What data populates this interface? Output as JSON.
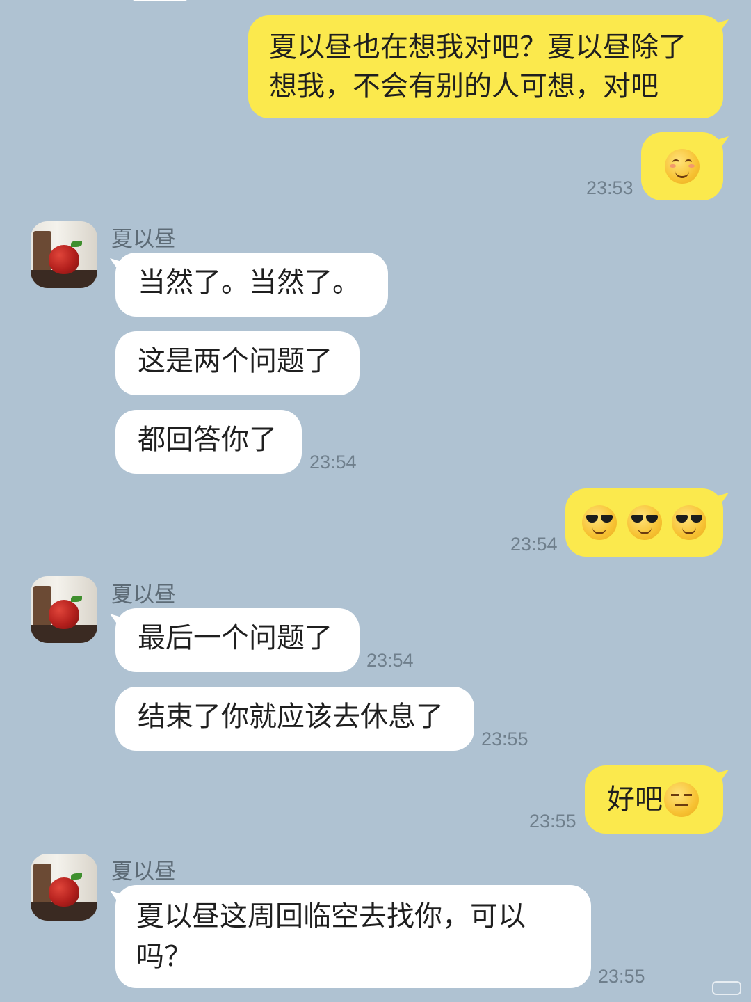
{
  "contact": {
    "name": "夏以昼"
  },
  "messages": [
    {
      "from": "me",
      "text": "夏以昼也在想我对吧？夏以昼除了想我，不会有别的人可想，对吧"
    },
    {
      "from": "me",
      "emoji": [
        "smiling-face-icon"
      ],
      "time": "23:53"
    },
    {
      "from": "contact",
      "text": "当然了。当然了。"
    },
    {
      "from": "contact",
      "text": "这是两个问题了"
    },
    {
      "from": "contact",
      "text": "都回答你了",
      "time": "23:54"
    },
    {
      "from": "me",
      "emoji": [
        "sunglasses-face-icon",
        "sunglasses-face-icon",
        "sunglasses-face-icon"
      ],
      "time": "23:54"
    },
    {
      "from": "contact",
      "text": "最后一个问题了",
      "time": "23:54"
    },
    {
      "from": "contact",
      "text": "结束了你就应该去休息了",
      "time": "23:55"
    },
    {
      "from": "me",
      "text": "好吧",
      "emoji": [
        "expressionless-face-icon"
      ],
      "time": "23:55"
    },
    {
      "from": "contact",
      "text": "夏以昼这周回临空去找你，可以吗？",
      "time": "23:55"
    }
  ]
}
